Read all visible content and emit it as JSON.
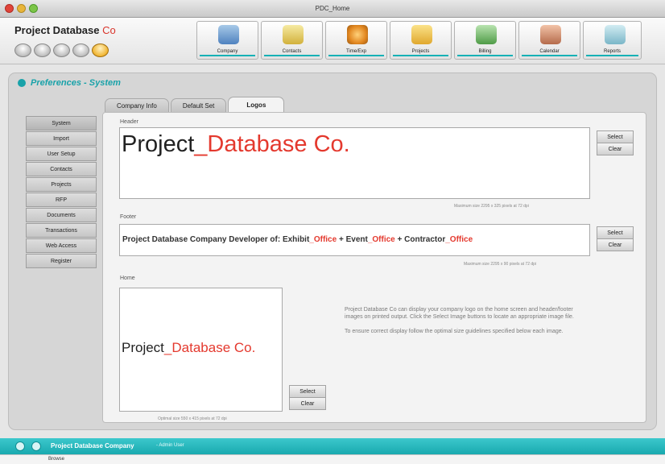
{
  "window": {
    "title": "PDC_Home"
  },
  "app": {
    "name": "Project Database",
    "name_suffix": "Co"
  },
  "toolbar": {
    "items": [
      {
        "label": "Company",
        "icon": "building-icon"
      },
      {
        "label": "Contacts",
        "icon": "contacts-icon"
      },
      {
        "label": "Time/Exp",
        "icon": "clock-icon"
      },
      {
        "label": "Projects",
        "icon": "projects-icon"
      },
      {
        "label": "Billing",
        "icon": "billing-icon"
      },
      {
        "label": "Calendar",
        "icon": "calendar-icon"
      },
      {
        "label": "Reports",
        "icon": "reports-icon"
      }
    ]
  },
  "page": {
    "title": "Preferences - System"
  },
  "tabs": [
    {
      "label": "Company Info"
    },
    {
      "label": "Default Set"
    },
    {
      "label": "Logos",
      "active": true
    }
  ],
  "sidebar": {
    "items": [
      {
        "label": "System"
      },
      {
        "label": "Import"
      },
      {
        "label": "User Setup"
      },
      {
        "label": "Contacts"
      },
      {
        "label": "Projects"
      },
      {
        "label": "RFP"
      },
      {
        "label": "Documents"
      },
      {
        "label": "Transactions"
      },
      {
        "label": "Web Access"
      },
      {
        "label": "Register"
      }
    ]
  },
  "header_section": {
    "label": "Header",
    "logo_main": "Project",
    "logo_accent": "_Database Co.",
    "hint": "Maximum size 2295 x 325 pixels at 72 dpi",
    "select_label": "Select",
    "clear_label": "Clear"
  },
  "footer_section": {
    "label": "Footer",
    "text_1": "Project Database Company Developer of: Exhibit",
    "accent_1": "_Office",
    "text_2": " + Event",
    "accent_2": "_Office",
    "text_3": " + Contractor",
    "accent_3": "_Office",
    "hint": "Maximum size 2295 x 90 pixels at 72 dpi",
    "select_label": "Select",
    "clear_label": "Clear"
  },
  "home_section": {
    "label": "Home",
    "logo_main": "Project",
    "logo_accent": "_Database Co.",
    "hint": "Optimal size 550 x 415 pixels at 72 dpi",
    "select_label": "Select",
    "clear_label": "Clear"
  },
  "info": {
    "paragraph_1": "Project Database Co can display your company logo on the home screen and header/footer images on printed output. Click the Select Image buttons to locate an appropriate image file.",
    "paragraph_2": "To ensure correct display follow the optimal size guidelines specified below each image."
  },
  "status": {
    "company": "Project Database Company",
    "user": "- Admin User"
  },
  "bottom": {
    "count": "Browse"
  },
  "colors": {
    "accent": "#19a9af",
    "logo_red": "#e4392e"
  }
}
